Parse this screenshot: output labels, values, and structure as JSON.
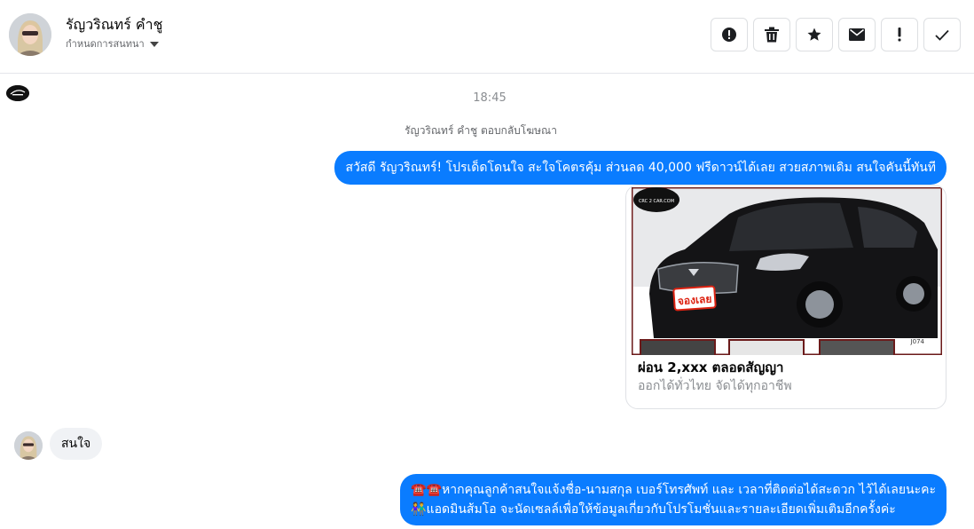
{
  "header": {
    "contact_name": "รัญวริณทร์ คำชู",
    "sub_label": "กำหนดการสนทนา",
    "actions": [
      {
        "name": "report-button",
        "icon": "alert-circle-icon"
      },
      {
        "name": "delete-button",
        "icon": "trash-icon"
      },
      {
        "name": "star-button",
        "icon": "star-icon"
      },
      {
        "name": "mark-unread-button",
        "icon": "envelope-icon"
      },
      {
        "name": "important-button",
        "icon": "exclamation-icon"
      },
      {
        "name": "done-button",
        "icon": "check-icon"
      }
    ]
  },
  "conversation": {
    "timestamp": "18:45",
    "reply_note": "รัญวริณทร์ คำชู ตอบกลับโฆษณา",
    "outgoing_1": "สวัสดี รัญวริณทร์! โปรเด็ดโดนใจ สะใจโคตรคุ้ม ส่วนลด 40,000 ฟรีดาวน์ได้เลย สวยสภาพเดิม สนใจคันนี้ทันที",
    "card": {
      "title": "ผ่อน 2,xxx ตลอดสัญญา",
      "subtitle": "ออกได้ทั่วไทย จัดได้ทุกอาชีพ",
      "image_badge": "จองเลย",
      "image_brand": "CRC 2 CAR.COM",
      "image_plate": "J074"
    },
    "incoming_1": "สนใจ",
    "outgoing_2_line1": "☎️☎️หากคุณลูกค้าสนใจแจ้งชื่อ-นามสกุล เบอร์โทรศัพท์ และ เวลาที่ติดต่อได้สะดวก ไว้ได้เลยนะคะ",
    "outgoing_2_line2": "👫แอดมินส้มโอ จะนัดเซลล์เพื่อให้ข้อมูลเกี่ยวกับโปรโมชั่นและรายละเอียดเพิ่มเติมอีกครั้งค่ะ"
  },
  "colors": {
    "outgoing_bubble": "#0a7cff",
    "incoming_bubble": "#f0f2f5",
    "muted_text": "#8a8d91"
  }
}
